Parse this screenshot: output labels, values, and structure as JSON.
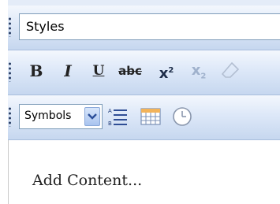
{
  "toolbar1": {
    "styles_value": "Styles"
  },
  "toolbar2": {
    "bold": "B",
    "italic": "I",
    "underline": "U",
    "strike": "abc",
    "sup_base": "x",
    "sup_exp": "2",
    "sub_base": "x",
    "sub_exp": "2"
  },
  "toolbar3": {
    "symbols_value": "Symbols",
    "icons": [
      "dropdown-arrow-icon",
      "numbered-list-icon",
      "table-icon",
      "clock-icon"
    ]
  },
  "editor": {
    "placeholder_text": "Add Content..."
  },
  "colors": {
    "toolbar_top": "#f3f7fd",
    "toolbar_bottom": "#c6d7ef",
    "grip": "#2a3f66",
    "select_border": "#7f9db9"
  }
}
